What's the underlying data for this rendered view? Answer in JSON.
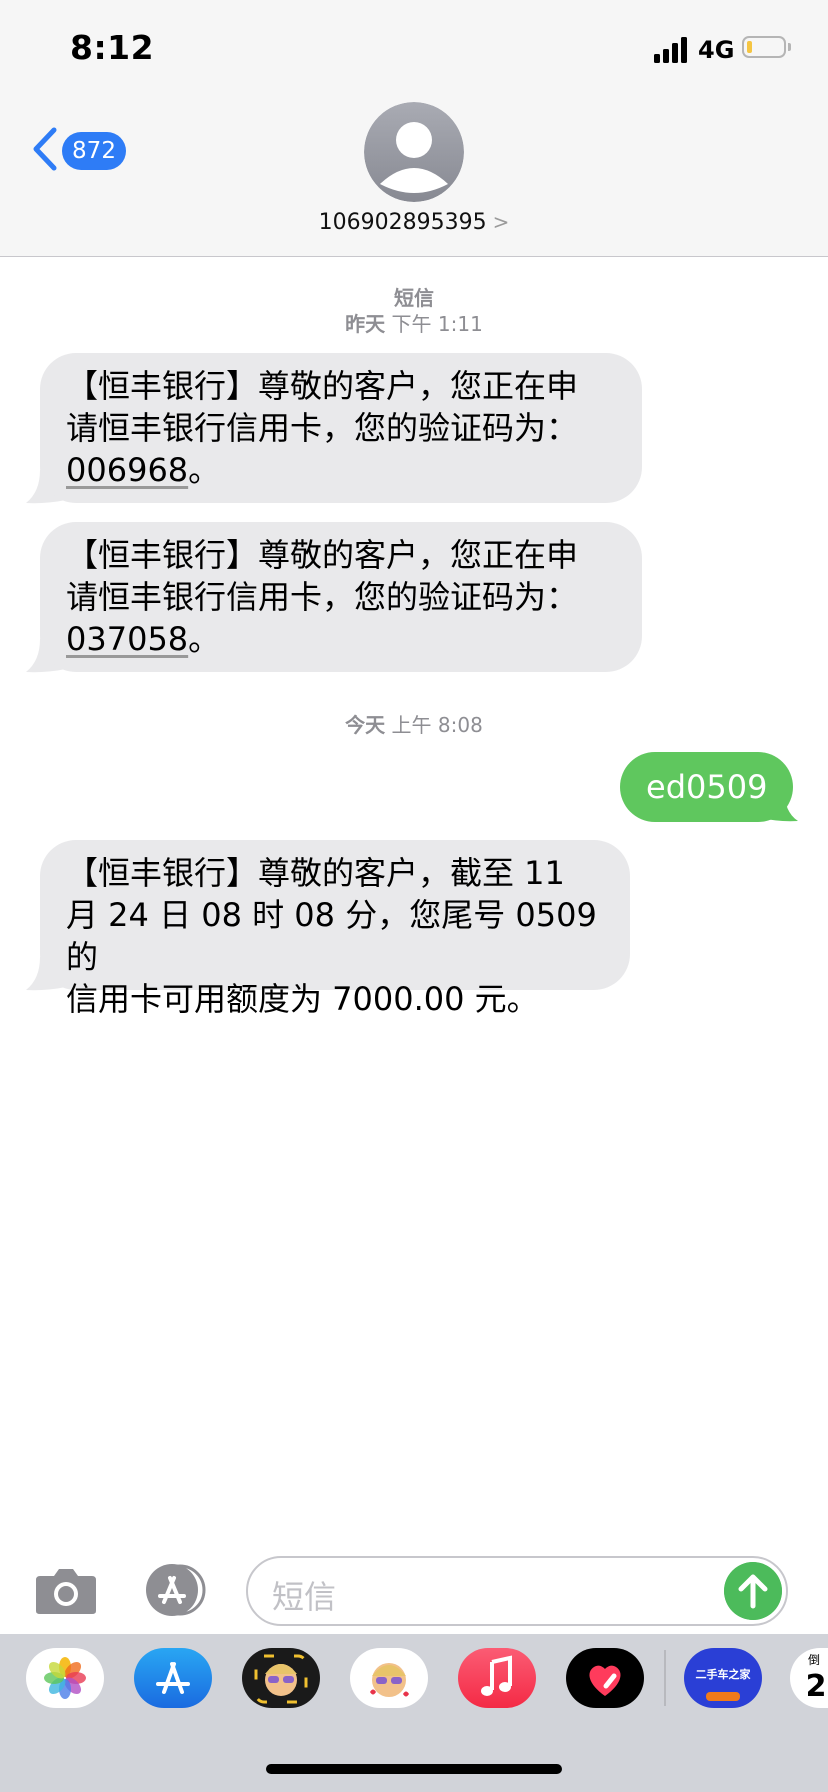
{
  "status_bar": {
    "time": "8:12",
    "network": "4G"
  },
  "nav": {
    "back_count": "872",
    "sender": "106902895395",
    "sender_chevron": ">"
  },
  "thread": {
    "label": "短信",
    "date1": "昨天",
    "time1": "下午 1:11",
    "date2": "今天",
    "time2": "上午 8:08",
    "messages": [
      {
        "line1": "【恒丰银行】尊敬的客户，您正在申",
        "line2": "请恒丰银行信用卡，您的验证码为：",
        "code": "006968",
        "end": "。"
      },
      {
        "line1": "【恒丰银行】尊敬的客户，您正在申",
        "line2": "请恒丰银行信用卡，您的验证码为：",
        "code": "037058",
        "end": "。"
      },
      {
        "line1": "【恒丰银行】尊敬的客户，截至 11",
        "line2": "月 24 日 08 时 08 分，您尾号 0509 的",
        "line3": "信用卡可用额度为 7000.00 元。"
      }
    ],
    "sent": "ed0509"
  },
  "input": {
    "placeholder": "短信"
  },
  "drawer": {
    "apps": [
      "photos-icon",
      "app-store-icon",
      "memoji-icon",
      "animoji-icon",
      "music-icon",
      "digital-touch-icon",
      "che168-icon",
      "countdown-icon"
    ],
    "che168_text": "二手车之家",
    "countdown_digit": "2",
    "countdown_top": "倒"
  },
  "colors": {
    "accent": "#2e7cf6",
    "sent_bubble": "#5fc75e",
    "received_bubble": "#e9e9eb",
    "send_button": "#4cbb5b"
  }
}
